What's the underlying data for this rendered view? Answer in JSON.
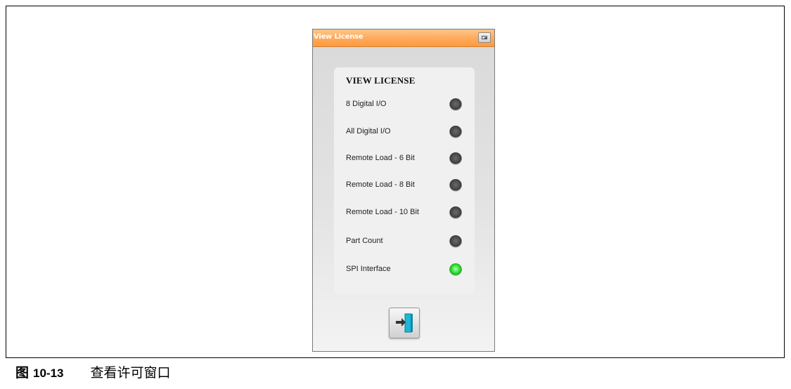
{
  "window": {
    "title": "View License",
    "titlebar_button_icon": "restore-window-icon"
  },
  "panel": {
    "heading": "VIEW LICENSE",
    "licenses": [
      {
        "label": "8 Digital I/O",
        "enabled": false
      },
      {
        "label": "All Digital I/O",
        "enabled": false
      },
      {
        "label": "Remote Load - 6 Bit",
        "enabled": false
      },
      {
        "label": "Remote Load - 8 Bit",
        "enabled": false
      },
      {
        "label": "Remote Load - 10 Bit",
        "enabled": false
      },
      {
        "label": "Part Count",
        "enabled": false
      },
      {
        "label": "SPI Interface",
        "enabled": true
      }
    ]
  },
  "exit_button": {
    "icon": "exit-door-icon"
  },
  "caption": {
    "figure_word": "图",
    "figure_number": "10-13",
    "title": "查看许可窗口"
  },
  "colors": {
    "titlebar": "#ff9a40",
    "led_on": "#22cc22",
    "led_off": "#4a4a4a",
    "door": "#1fb6d6"
  }
}
